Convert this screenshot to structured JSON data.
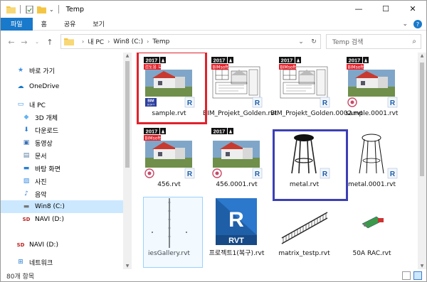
{
  "window": {
    "title": "Temp",
    "minimize": "—",
    "maximize": "☐",
    "close": "✕"
  },
  "ribbon": {
    "tabs": [
      "파일",
      "홈",
      "공유",
      "보기"
    ],
    "expand": "⌄",
    "help": "?"
  },
  "address": {
    "crumbs": [
      "내 PC",
      "Win8 (C:)",
      "Temp"
    ],
    "search_placeholder": "Temp 검색"
  },
  "nav": {
    "items": [
      {
        "label": "바로 가기",
        "icon": "star-icon"
      },
      {
        "label": "OneDrive",
        "icon": "cloud-icon"
      },
      {
        "label": "내 PC",
        "icon": "computer-icon"
      },
      {
        "label": "3D 개체",
        "icon": "cube-icon"
      },
      {
        "label": "다운로드",
        "icon": "download-icon"
      },
      {
        "label": "동영상",
        "icon": "video-icon"
      },
      {
        "label": "문서",
        "icon": "document-icon"
      },
      {
        "label": "바탕 화면",
        "icon": "desktop-icon"
      },
      {
        "label": "사진",
        "icon": "picture-icon"
      },
      {
        "label": "음악",
        "icon": "music-icon"
      },
      {
        "label": "Win8 (C:)",
        "icon": "drive-icon"
      },
      {
        "label": "NAVI (D:)",
        "icon": "sd-drive-icon"
      },
      {
        "label": "NAVI (D:)",
        "icon": "sd-drive-icon"
      },
      {
        "label": "네트워크",
        "icon": "network-icon"
      }
    ]
  },
  "files": [
    {
      "name": "sample.rvt",
      "year": "2017",
      "tag": "검토용 모델",
      "thumb": "render-house",
      "badge": "bim-soft"
    },
    {
      "name": "BIM_Projekt_Golden.rvt",
      "year": "2017",
      "tag": "BIMsoft",
      "thumb": "drawing-sheet",
      "badge": "revit-r"
    },
    {
      "name": "BIM_Projekt_Golden.0002.rvt",
      "year": "2017",
      "tag": "BIMsoft",
      "thumb": "drawing-sheet",
      "badge": "revit-r"
    },
    {
      "name": "sample.0001.rvt",
      "year": "2017",
      "tag": "BIMsoft",
      "thumb": "render-house",
      "badge": "seal"
    },
    {
      "name": "456.rvt",
      "year": "2017",
      "tag": "BIMsoft",
      "thumb": "render-house",
      "badge": "seal"
    },
    {
      "name": "456.0001.rvt",
      "year": "2017",
      "tag": "",
      "thumb": "render-house",
      "badge": "seal"
    },
    {
      "name": "metal.rvt",
      "year": "",
      "tag": "",
      "thumb": "stool-black",
      "badge": "revit-r"
    },
    {
      "name": "metal.0001.rvt",
      "year": "",
      "tag": "",
      "thumb": "stool-outline",
      "badge": "revit-r"
    },
    {
      "name": "iesGallery.rvt",
      "year": "",
      "tag": "",
      "thumb": "gallery-line",
      "badge": ""
    },
    {
      "name": "프로젝트1(복구).rvt",
      "year": "",
      "tag": "",
      "thumb": "rvt-icon",
      "badge": ""
    },
    {
      "name": "matrix_testp.rvt",
      "year": "",
      "tag": "",
      "thumb": "railing",
      "badge": ""
    },
    {
      "name": "50A RAC.rvt",
      "year": "",
      "tag": "",
      "thumb": "pipe-fitting",
      "badge": ""
    }
  ],
  "badge_texts": {
    "bim": "BIM",
    "soft": "SOFT",
    "r": "R",
    "rvt": "RVT"
  },
  "status": {
    "count": "80개 항목"
  },
  "colors": {
    "accent": "#1979ca",
    "red_frame": "#e0222b",
    "blue_frame": "#3c3fb5"
  }
}
